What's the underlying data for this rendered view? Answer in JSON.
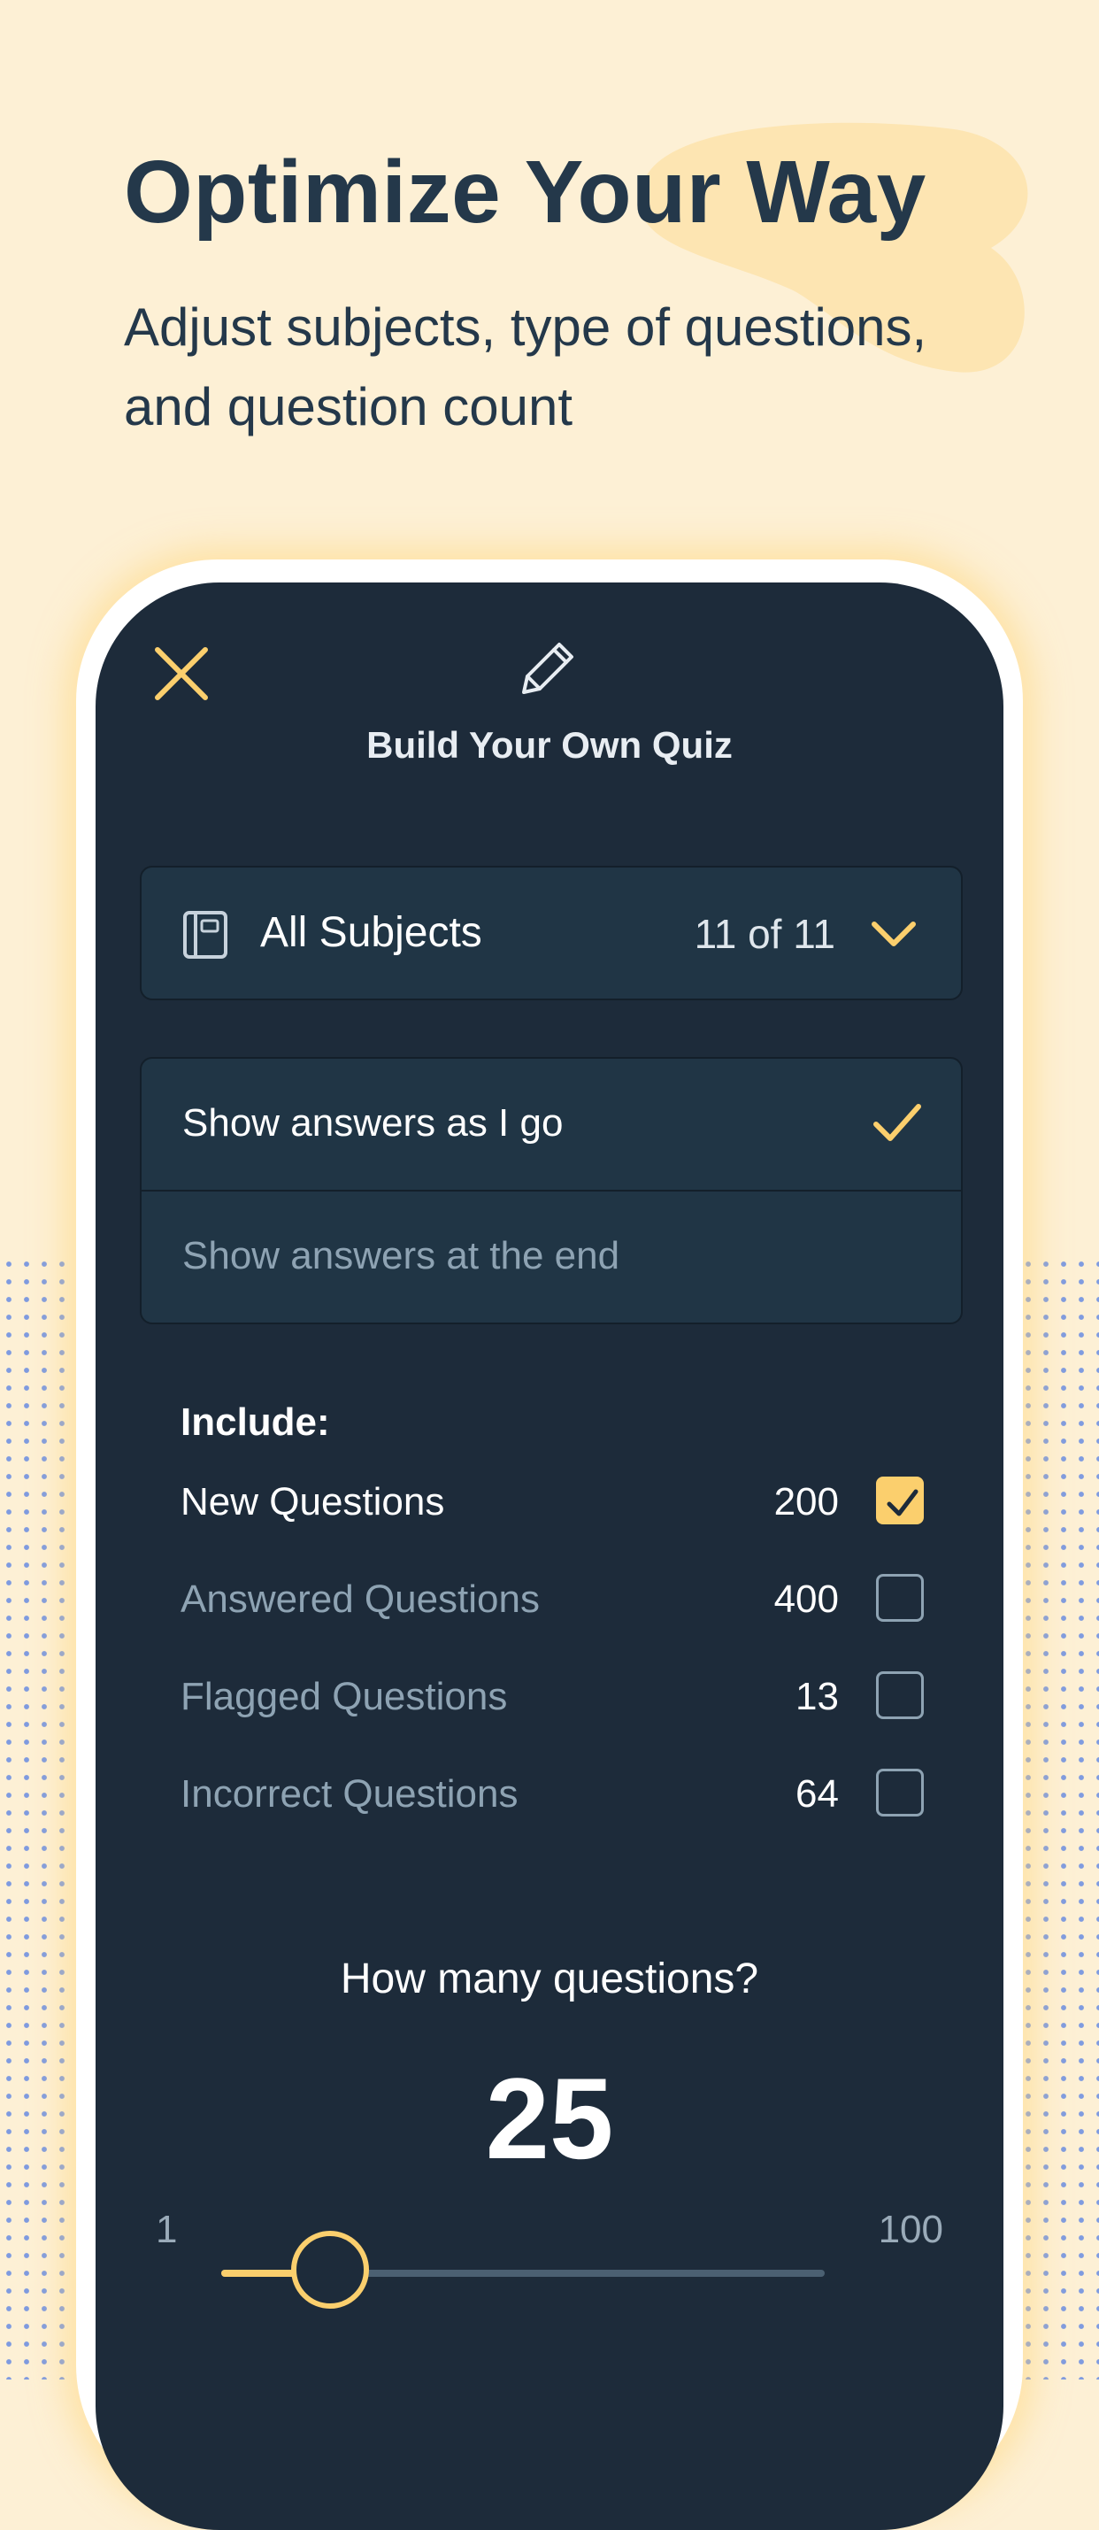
{
  "hero": {
    "headline": "Optimize Your Way",
    "subtitle": "Adjust subjects, type of questions, and question count"
  },
  "screen": {
    "title": "Build Your Own Quiz",
    "icons": {
      "close": "close-icon",
      "header": "pencil-icon",
      "subject": "book-icon",
      "dropdown": "chevron-down-icon"
    },
    "subjects": {
      "label": "All Subjects",
      "count": "11 of 11"
    },
    "answer_modes": [
      {
        "label": "Show answers as I go",
        "selected": true
      },
      {
        "label": "Show answers at the end",
        "selected": false
      }
    ],
    "include": {
      "label": "Include:",
      "items": [
        {
          "name": "New Questions",
          "count": "200",
          "checked": true
        },
        {
          "name": "Answered Questions",
          "count": "400",
          "checked": false
        },
        {
          "name": "Flagged Questions",
          "count": "13",
          "checked": false
        },
        {
          "name": "Incorrect Questions",
          "count": "64",
          "checked": false
        }
      ]
    },
    "question_count": {
      "prompt": "How many questions?",
      "value": "25",
      "min": "1",
      "max": "100",
      "slider_fraction": 0.18
    }
  },
  "colors": {
    "accent": "#fbcf6d",
    "screen_bg": "#1d2b3a",
    "page_bg": "#fdf0d5",
    "headline": "#24384a"
  }
}
